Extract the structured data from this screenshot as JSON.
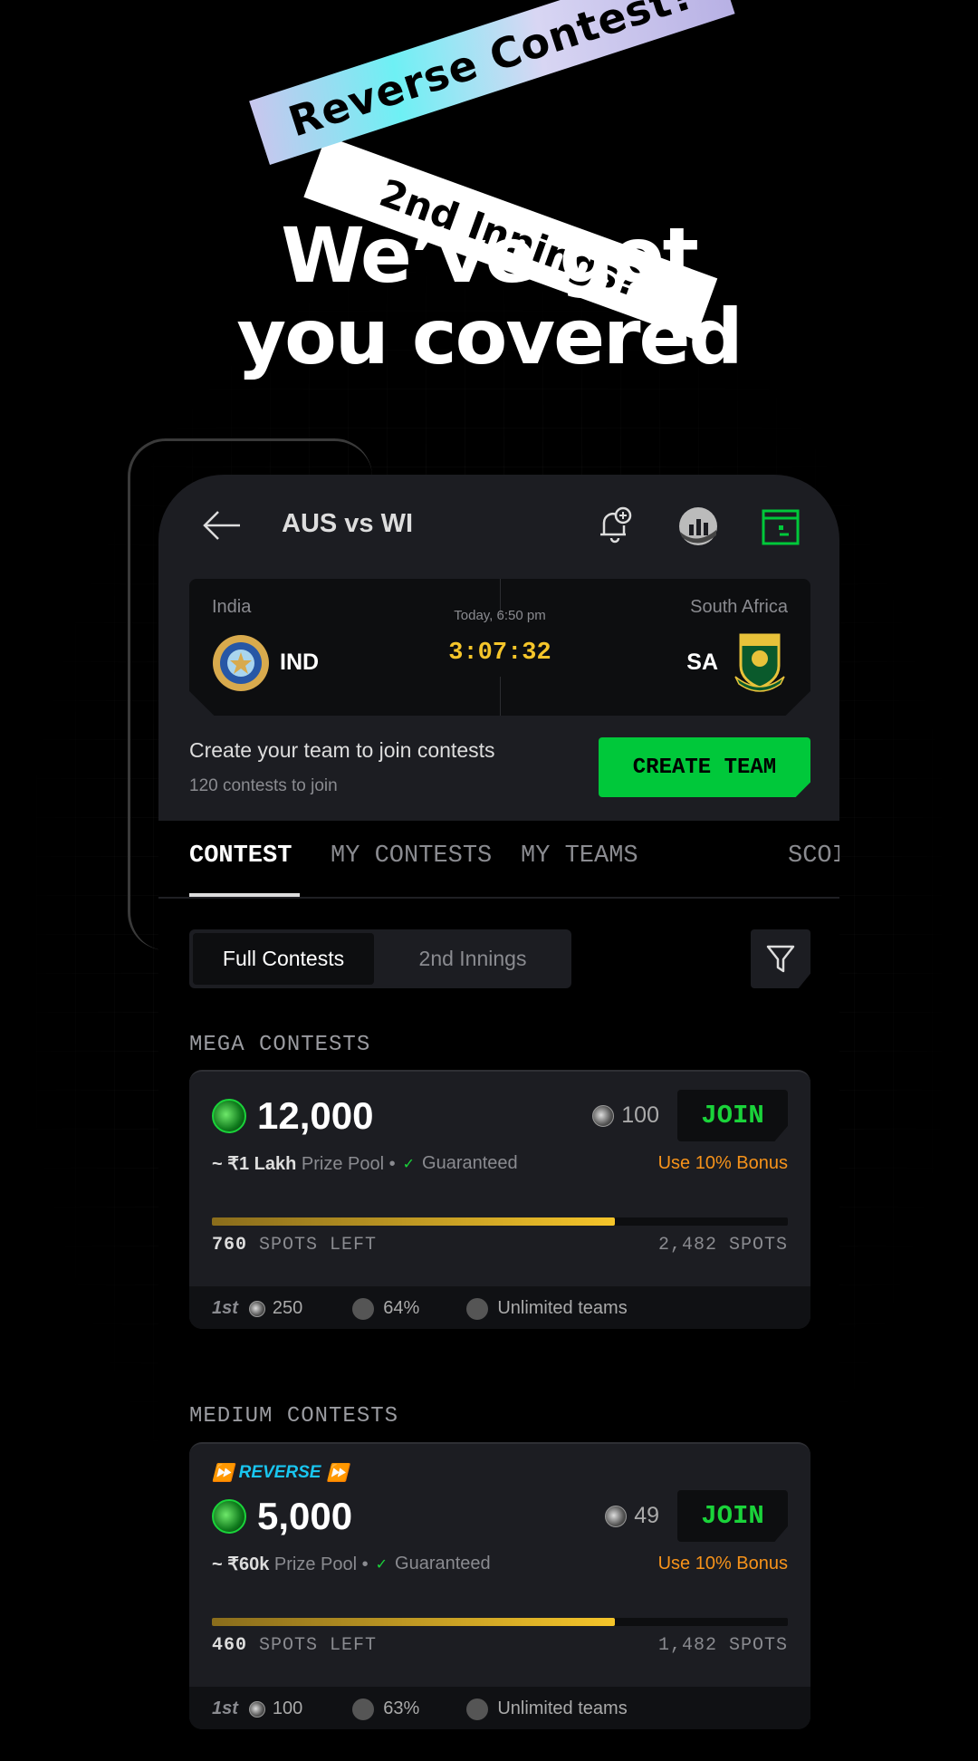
{
  "promo": {
    "ribbon1": "Reverse Contest?",
    "ribbon2": "2nd Innings?",
    "headline1": "We’ve got",
    "headline2": "you covered"
  },
  "header": {
    "title": "AUS vs WI",
    "icons": [
      "back-arrow-icon",
      "bell-plus-icon",
      "stats-icon",
      "wallet-icon"
    ],
    "accent": "#00c83a"
  },
  "match": {
    "team1_name": "India",
    "team1_code": "IND",
    "team2_name": "South Africa",
    "team2_code": "SA",
    "time": "Today, 6:50 pm",
    "countdown": "3:07:32",
    "countdown_color": "#f5c52a"
  },
  "create": {
    "text": "Create your team to join contests",
    "sub": "120 contests to join",
    "button": "CREATE TEAM"
  },
  "tabs": [
    {
      "label": "CONTEST",
      "active": true
    },
    {
      "label": "MY CONTESTS"
    },
    {
      "label": "MY TEAMS"
    },
    {
      "label": "SCOI"
    }
  ],
  "segment": {
    "options": [
      "Full Contests",
      "2nd Innings"
    ],
    "selected": "Full Contests"
  },
  "sections": [
    "MEGA CONTESTS",
    "MEDIUM CONTESTS"
  ],
  "contests": [
    {
      "reverse": false,
      "amount": "12,000",
      "entry": "100",
      "join": "JOIN",
      "prize_prefix": "~ ₹1 Lakh",
      "prize_label": "Prize Pool •",
      "guaranteed": "Guaranteed",
      "bonus": "Use 10% Bonus",
      "fill_percent": 70,
      "spots_left": "760",
      "spots_left_label": "SPOTS LEFT",
      "total_spots": "2,482 SPOTS",
      "first": "1st",
      "first_prize": "250",
      "win_pct": "64%",
      "teams": "Unlimited teams"
    },
    {
      "reverse": true,
      "reverse_label": "REVERSE",
      "amount": "5,000",
      "entry": "49",
      "join": "JOIN",
      "prize_prefix": "~ ₹60k",
      "prize_label": "Prize Pool •",
      "guaranteed": "Guaranteed",
      "bonus": "Use 10% Bonus",
      "fill_percent": 70,
      "spots_left": "460",
      "spots_left_label": "SPOTS LEFT",
      "total_spots": "1,482 SPOTS",
      "first": "1st",
      "first_prize": "100",
      "win_pct": "63%",
      "teams": "Unlimited teams"
    }
  ]
}
